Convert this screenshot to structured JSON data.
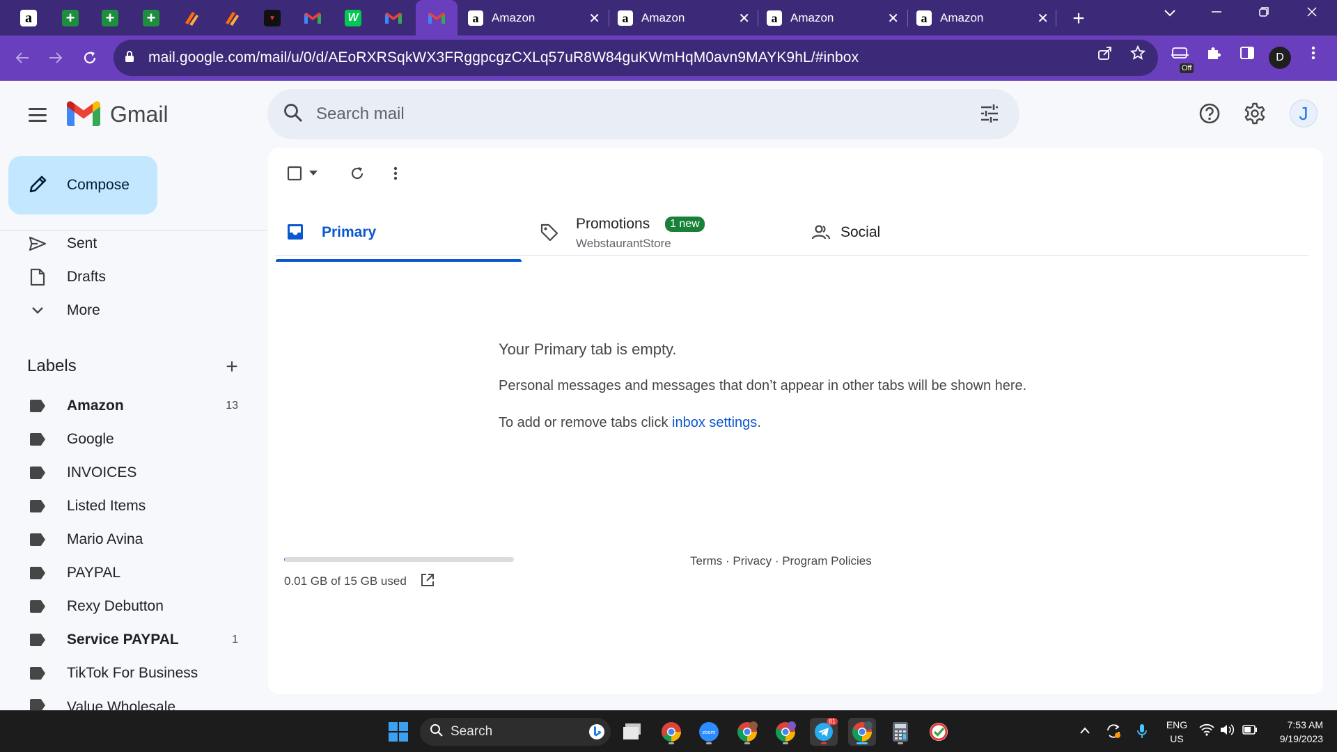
{
  "browser": {
    "tabs": [
      {
        "label": "Amazon",
        "close": "✕"
      },
      {
        "label": "Amazon",
        "close": "✕"
      },
      {
        "label": "Amazon",
        "close": "✕"
      },
      {
        "label": "Amazon",
        "close": "✕"
      }
    ],
    "new_tab": "+",
    "url": "mail.google.com/mail/u/0/d/AEoRXRSqkWX3FRggpcgzCXLq57uR8W84guKWmHqM0avn9MAYK9hL/#inbox",
    "profile_initial": "D",
    "extension_badge": "Off"
  },
  "gmail": {
    "brand": "Gmail",
    "search_placeholder": "Search mail",
    "avatar_initial": "J",
    "compose_label": "Compose",
    "nav": [
      {
        "label": "Sent"
      },
      {
        "label": "Drafts"
      },
      {
        "label": "More"
      }
    ],
    "labels_title": "Labels",
    "labels_add": "+",
    "labels": [
      {
        "label": "Amazon",
        "count": "13",
        "bold": true
      },
      {
        "label": "Google",
        "count": "",
        "bold": false
      },
      {
        "label": "INVOICES",
        "count": "",
        "bold": false
      },
      {
        "label": "Listed Items",
        "count": "",
        "bold": false
      },
      {
        "label": "Mario Avina",
        "count": "",
        "bold": false
      },
      {
        "label": "PAYPAL",
        "count": "",
        "bold": false
      },
      {
        "label": "Rexy Debutton",
        "count": "",
        "bold": false
      },
      {
        "label": "Service PAYPAL",
        "count": "1",
        "bold": true
      },
      {
        "label": "TikTok For Business",
        "count": "",
        "bold": false
      },
      {
        "label": "Value Wholesale",
        "count": "",
        "bold": false
      }
    ],
    "categories": {
      "primary": "Primary",
      "promotions": "Promotions",
      "promotions_badge": "1 new",
      "promotions_sender": "WebstaurantStore",
      "social": "Social"
    },
    "empty": {
      "title": "Your Primary tab is empty.",
      "description": "Personal messages and messages that don’t appear in other tabs will be shown here.",
      "hint_prefix": "To add or remove tabs click ",
      "hint_link": "inbox settings",
      "hint_suffix": "."
    },
    "storage": {
      "text": "0.01 GB of 15 GB used",
      "fraction": 0.0007
    },
    "footer": "Terms · Privacy · Program Policies"
  },
  "taskbar": {
    "search_label": "Search",
    "lang_top": "ENG",
    "lang_bottom": "US",
    "time": "7:53 AM",
    "date": "9/19/2023",
    "telegram_badge": "81"
  },
  "colors": {
    "tabstrip": "#3c2a78",
    "toolbar": "#6a3fbe",
    "compose": "#c2e7ff",
    "accent": "#0b57d0",
    "badge_green": "#188038"
  }
}
